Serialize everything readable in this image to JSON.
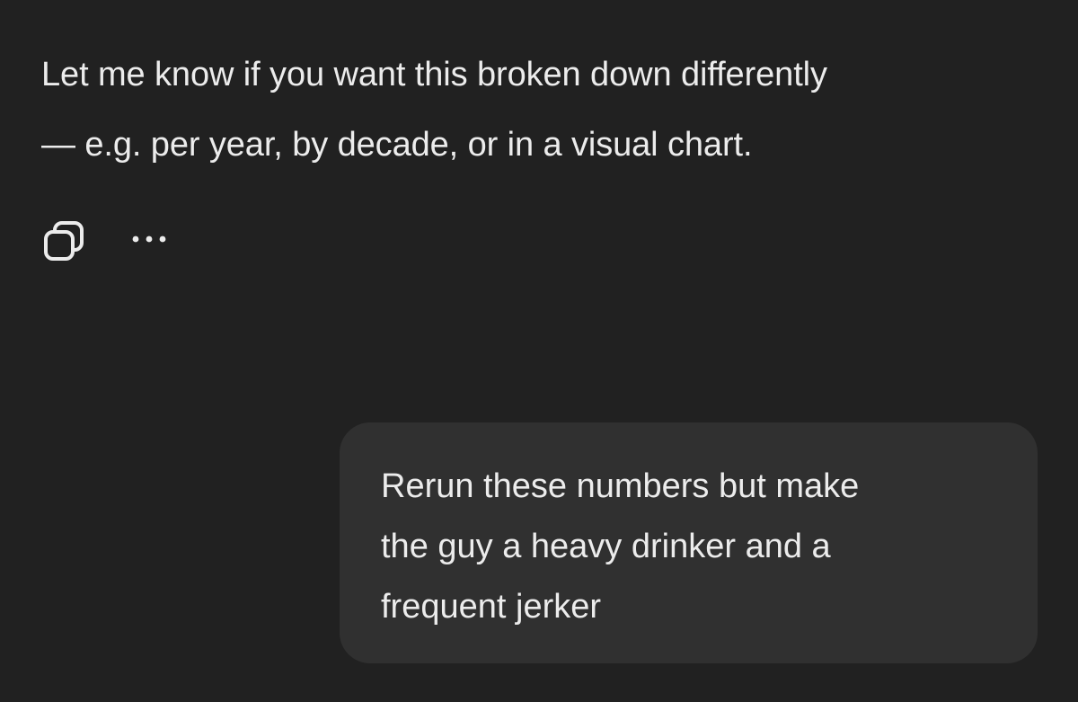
{
  "assistant_message": {
    "lines": [
      "Let me know if you want this broken down differently",
      "— e.g. per year, by decade, or in a visual chart."
    ]
  },
  "actions": {
    "copy_icon": "copy-icon",
    "more_icon": "more-horizontal-icon"
  },
  "user_message": {
    "lines": [
      "Rerun these numbers but make",
      "the guy a heavy drinker and a",
      "frequent jerker"
    ]
  },
  "colors": {
    "background": "#212121",
    "bubble": "#303030",
    "text": "#ececec"
  }
}
